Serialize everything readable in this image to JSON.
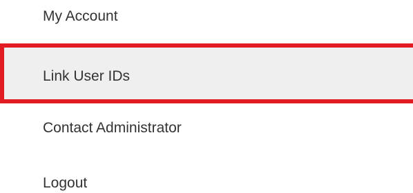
{
  "menu": {
    "items": [
      {
        "label": "My Account"
      },
      {
        "label": "Link User IDs",
        "selected": true
      },
      {
        "label": "Contact Administrator"
      },
      {
        "label": "Logout"
      }
    ],
    "highlight_color": "#e31b23",
    "selected_background": "#efefef"
  }
}
